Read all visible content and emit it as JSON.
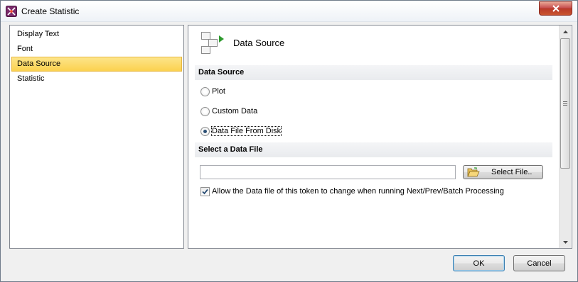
{
  "window": {
    "title": "Create Statistic",
    "app_icon": "fcs-express-icon"
  },
  "nav": {
    "items": [
      {
        "label": "Display Text",
        "selected": false
      },
      {
        "label": "Font",
        "selected": false
      },
      {
        "label": "Data Source",
        "selected": true
      },
      {
        "label": "Statistic",
        "selected": false
      }
    ]
  },
  "panel": {
    "title": "Data Source",
    "icon": "data-source-icon",
    "data_source_section": "Data Source",
    "options": [
      {
        "label": "Plot",
        "checked": false
      },
      {
        "label": "Custom Data",
        "checked": false
      },
      {
        "label": "Data File From Disk",
        "checked": true
      }
    ],
    "file_section": "Select a Data File",
    "file_value": "",
    "select_file_label": "Select File..",
    "allow_change_label": "Allow the Data file of this token to change when running Next/Prev/Batch Processing",
    "allow_change_checked": true
  },
  "buttons": {
    "ok": "OK",
    "cancel": "Cancel"
  },
  "colors": {
    "selection": "#fbd24f",
    "close_button": "#c75050",
    "radio_dot": "#2a4e74",
    "play_arrow": "#2e9b2e"
  }
}
